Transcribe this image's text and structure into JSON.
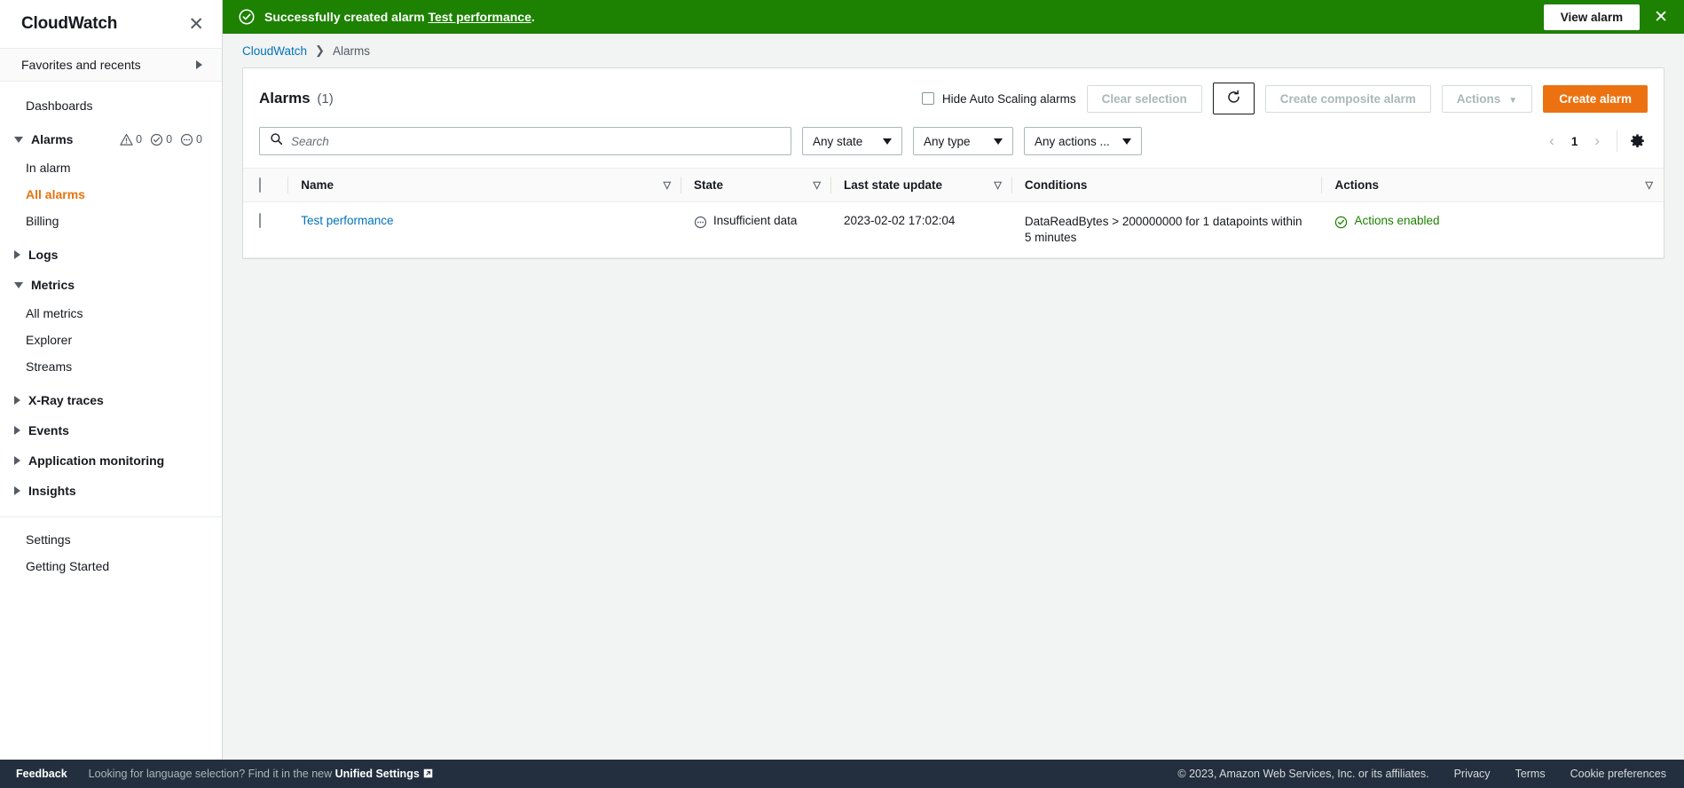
{
  "sidebar": {
    "title": "CloudWatch",
    "close_label": "✕",
    "favorites_label": "Favorites and recents",
    "items": [
      {
        "label": "Dashboards",
        "type": "item"
      },
      {
        "label": "Alarms",
        "type": "group",
        "expanded": true,
        "counts": [
          {
            "icon": "alarm-warning-icon",
            "value": "0"
          },
          {
            "icon": "alarm-ok-icon",
            "value": "0"
          },
          {
            "icon": "alarm-insufficient-icon",
            "value": "0"
          }
        ]
      },
      {
        "label": "In alarm",
        "type": "subitem"
      },
      {
        "label": "All alarms",
        "type": "subitem",
        "active": true
      },
      {
        "label": "Billing",
        "type": "subitem"
      },
      {
        "label": "Logs",
        "type": "group",
        "expanded": false
      },
      {
        "label": "Metrics",
        "type": "group",
        "expanded": true
      },
      {
        "label": "All metrics",
        "type": "subitem"
      },
      {
        "label": "Explorer",
        "type": "subitem"
      },
      {
        "label": "Streams",
        "type": "subitem"
      },
      {
        "label": "X-Ray traces",
        "type": "group",
        "expanded": false
      },
      {
        "label": "Events",
        "type": "group",
        "expanded": false
      },
      {
        "label": "Application monitoring",
        "type": "group",
        "expanded": false
      },
      {
        "label": "Insights",
        "type": "group",
        "expanded": false
      },
      {
        "label": "Settings",
        "type": "item"
      },
      {
        "label": "Getting Started",
        "type": "item"
      }
    ]
  },
  "flash": {
    "message_prefix": "Successfully created alarm ",
    "alarm_link": "Test performance",
    "message_suffix": ".",
    "view_button": "View alarm",
    "close_label": "✕",
    "color": "#1d8102"
  },
  "breadcrumb": {
    "root": "CloudWatch",
    "separator": "❯",
    "current": "Alarms"
  },
  "panel": {
    "title": "Alarms",
    "count": "(1)",
    "hide_autoscaling_label": "Hide Auto Scaling alarms",
    "clear_selection_label": "Clear selection",
    "refresh_label": "Refresh",
    "create_composite_label": "Create composite alarm",
    "actions_label": "Actions",
    "create_alarm_label": "Create alarm",
    "primary_color": "#ec7211"
  },
  "filters": {
    "search_placeholder": "Search",
    "search_value": "",
    "state_select": "Any state",
    "type_select": "Any type",
    "actions_select": "Any actions ...",
    "page_number": "1",
    "prev_label": "‹",
    "next_label": "›"
  },
  "table": {
    "columns": [
      {
        "label": "Name",
        "sortable": true
      },
      {
        "label": "State",
        "sortable": true
      },
      {
        "label": "Last state update",
        "sortable": true
      },
      {
        "label": "Conditions",
        "sortable": false
      },
      {
        "label": "Actions",
        "sortable": false
      }
    ],
    "rows": [
      {
        "name": "Test performance",
        "state": "Insufficient data",
        "state_icon": "insufficient-data-icon",
        "last_state_update": "2023-02-02 17:02:04",
        "conditions": "DataReadBytes > 200000000 for 1 datapoints within 5 minutes",
        "actions": "Actions enabled",
        "actions_icon": "check-circle-icon",
        "actions_color": "#1d8102"
      }
    ]
  },
  "footer": {
    "feedback": "Feedback",
    "language_prefix": "Looking for language selection? Find it in the new ",
    "language_link": "Unified Settings",
    "copyright": "© 2023, Amazon Web Services, Inc. or its affiliates.",
    "privacy": "Privacy",
    "terms": "Terms",
    "cookie_preferences": "Cookie preferences"
  }
}
